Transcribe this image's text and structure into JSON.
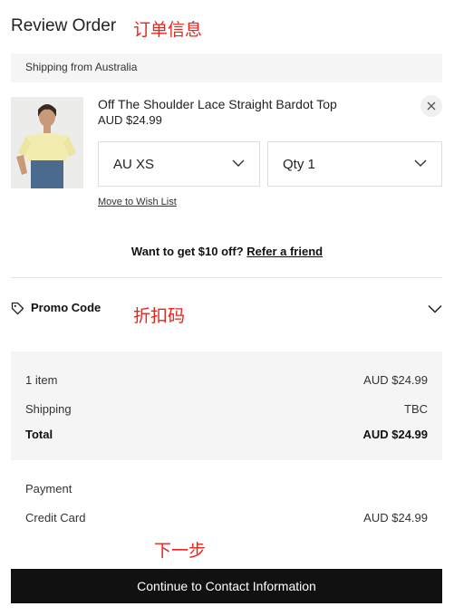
{
  "header": {
    "title": "Review Order",
    "annotation": "订单信息"
  },
  "shipping_bar": {
    "text": "Shipping from Australia"
  },
  "item": {
    "name": "Off The Shoulder Lace Straight Bardot Top",
    "price": "AUD $24.99",
    "size_value": "AU XS",
    "qty_value": "Qty 1",
    "wishlist_label": "Move to Wish List"
  },
  "referral": {
    "prompt": "Want to get $10 off?",
    "link": "Refer a friend"
  },
  "promo": {
    "label": "Promo Code",
    "annotation": "折扣码"
  },
  "summary": {
    "items_label": "1 item",
    "items_value": "AUD $24.99",
    "shipping_label": "Shipping",
    "shipping_value": "TBC",
    "total_label": "Total",
    "total_value": "AUD $24.99"
  },
  "payment": {
    "heading": "Payment",
    "method": "Credit Card",
    "amount": "AUD $24.99"
  },
  "cta": {
    "annotation": "下一步",
    "label": "Continue to Contact Information"
  },
  "colors": {
    "annotation_red": "#e8241c",
    "button_black": "#111111",
    "panel_gray": "#f5f5f5"
  }
}
